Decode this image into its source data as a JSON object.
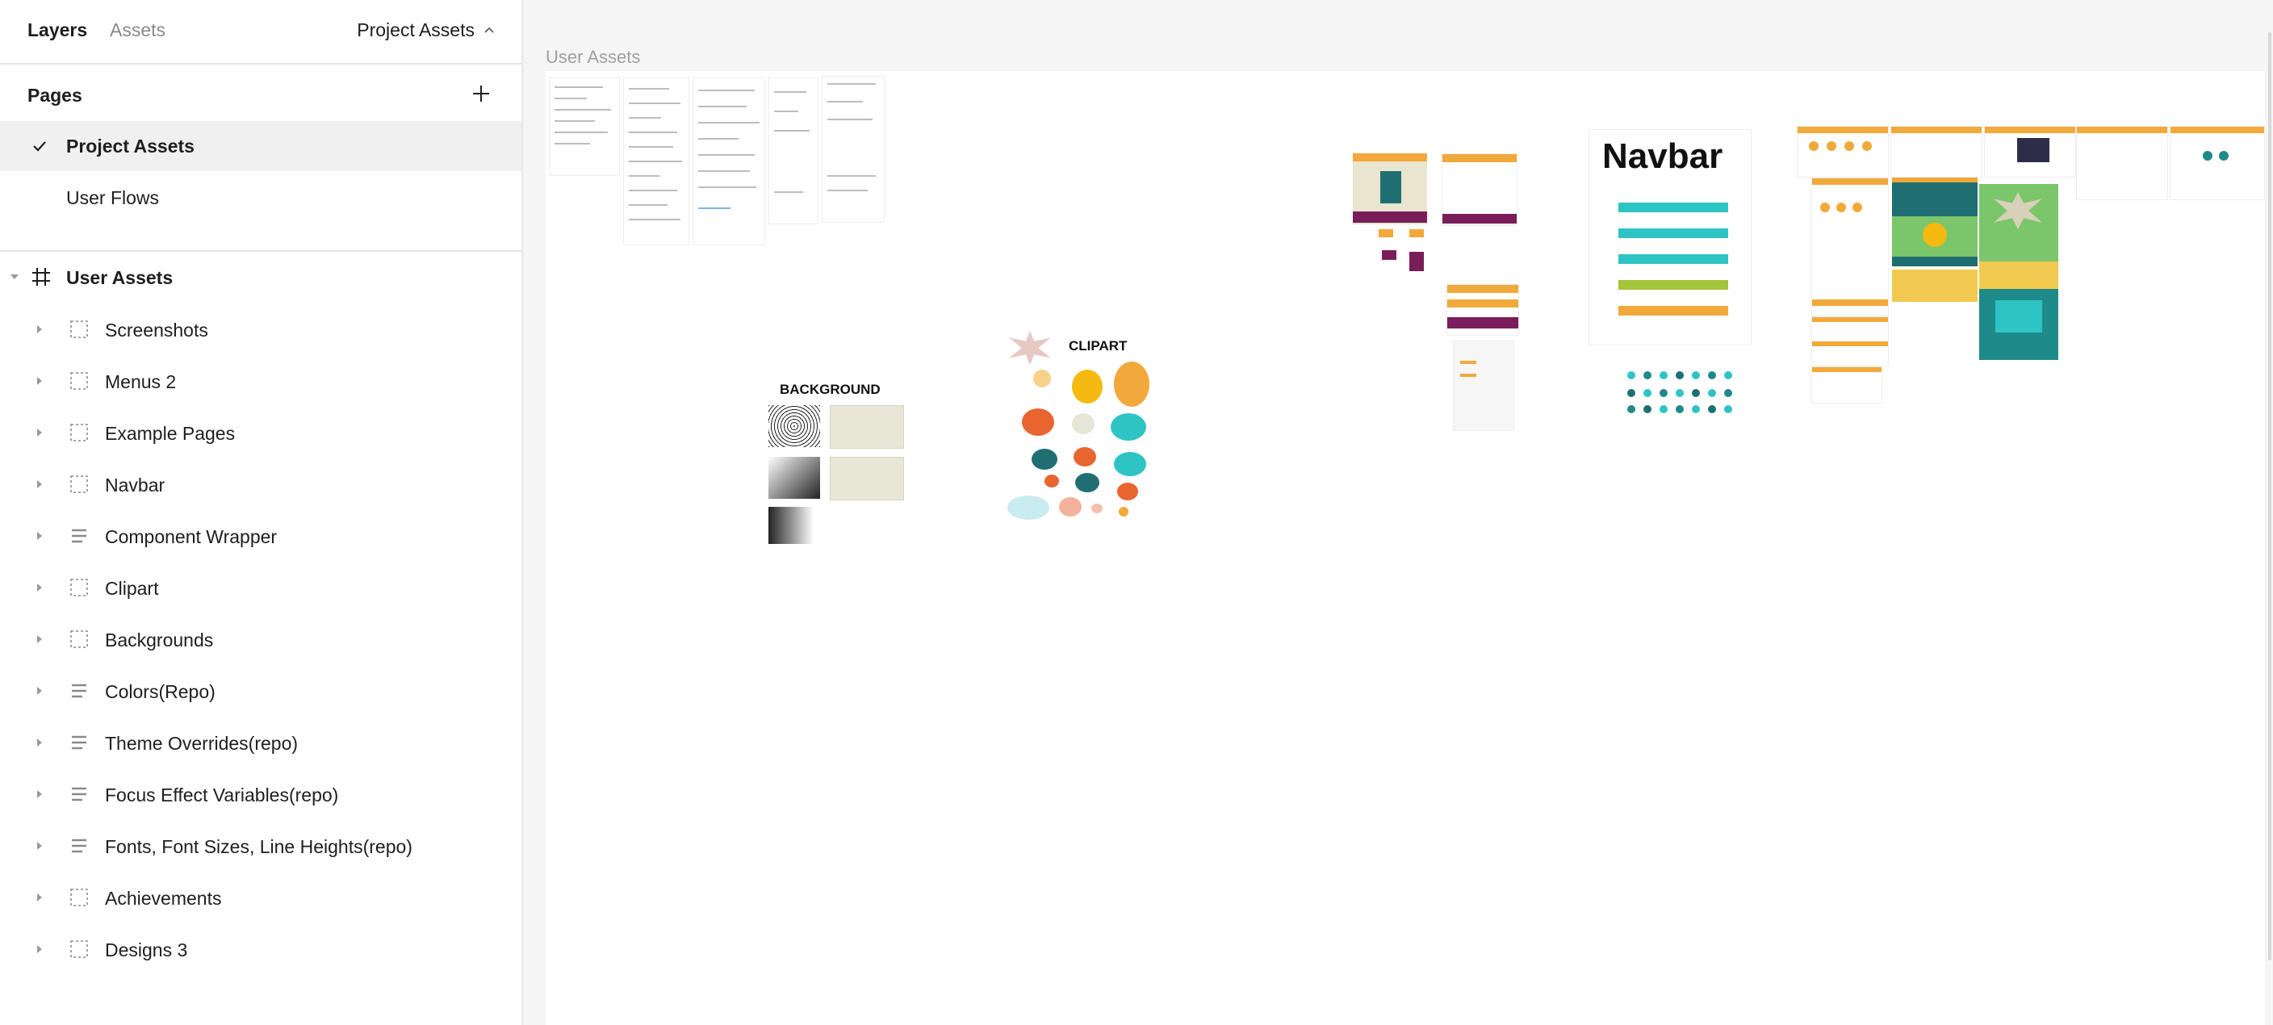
{
  "tabs": {
    "layers": "Layers",
    "assets": "Assets"
  },
  "page_switcher": {
    "label": "Project Assets"
  },
  "pages": {
    "title": "Pages",
    "items": [
      {
        "label": "Project Assets",
        "selected": true
      },
      {
        "label": "User Flows",
        "selected": false
      }
    ]
  },
  "frame": {
    "label": "User Assets"
  },
  "layers": [
    {
      "label": "Screenshots",
      "icon": "section-icon"
    },
    {
      "label": "Menus 2",
      "icon": "section-icon"
    },
    {
      "label": "Example Pages",
      "icon": "section-icon"
    },
    {
      "label": "Navbar",
      "icon": "section-icon"
    },
    {
      "label": "Component Wrapper",
      "icon": "autolayout-icon"
    },
    {
      "label": "Clipart",
      "icon": "section-icon"
    },
    {
      "label": "Backgrounds",
      "icon": "section-icon"
    },
    {
      "label": "Colors(Repo)",
      "icon": "autolayout-icon"
    },
    {
      "label": "Theme Overrides(repo)",
      "icon": "autolayout-icon"
    },
    {
      "label": "Focus Effect Variables(repo)",
      "icon": "autolayout-icon"
    },
    {
      "label": "Fonts, Font Sizes, Line Heights(repo)",
      "icon": "autolayout-icon"
    },
    {
      "label": "Achievements",
      "icon": "section-icon"
    },
    {
      "label": "Designs 3",
      "icon": "section-icon"
    }
  ],
  "canvas": {
    "frame_title": "User Assets",
    "background_label": "BACKGROUND",
    "clipart_label": "CLIPART",
    "navbar_label": "Navbar"
  },
  "colors": {
    "orange": "#f2a93b",
    "purple": "#7a1e5a",
    "teal": "#2ec4c4",
    "dark_teal": "#1f6f72",
    "coral": "#e8652f"
  }
}
